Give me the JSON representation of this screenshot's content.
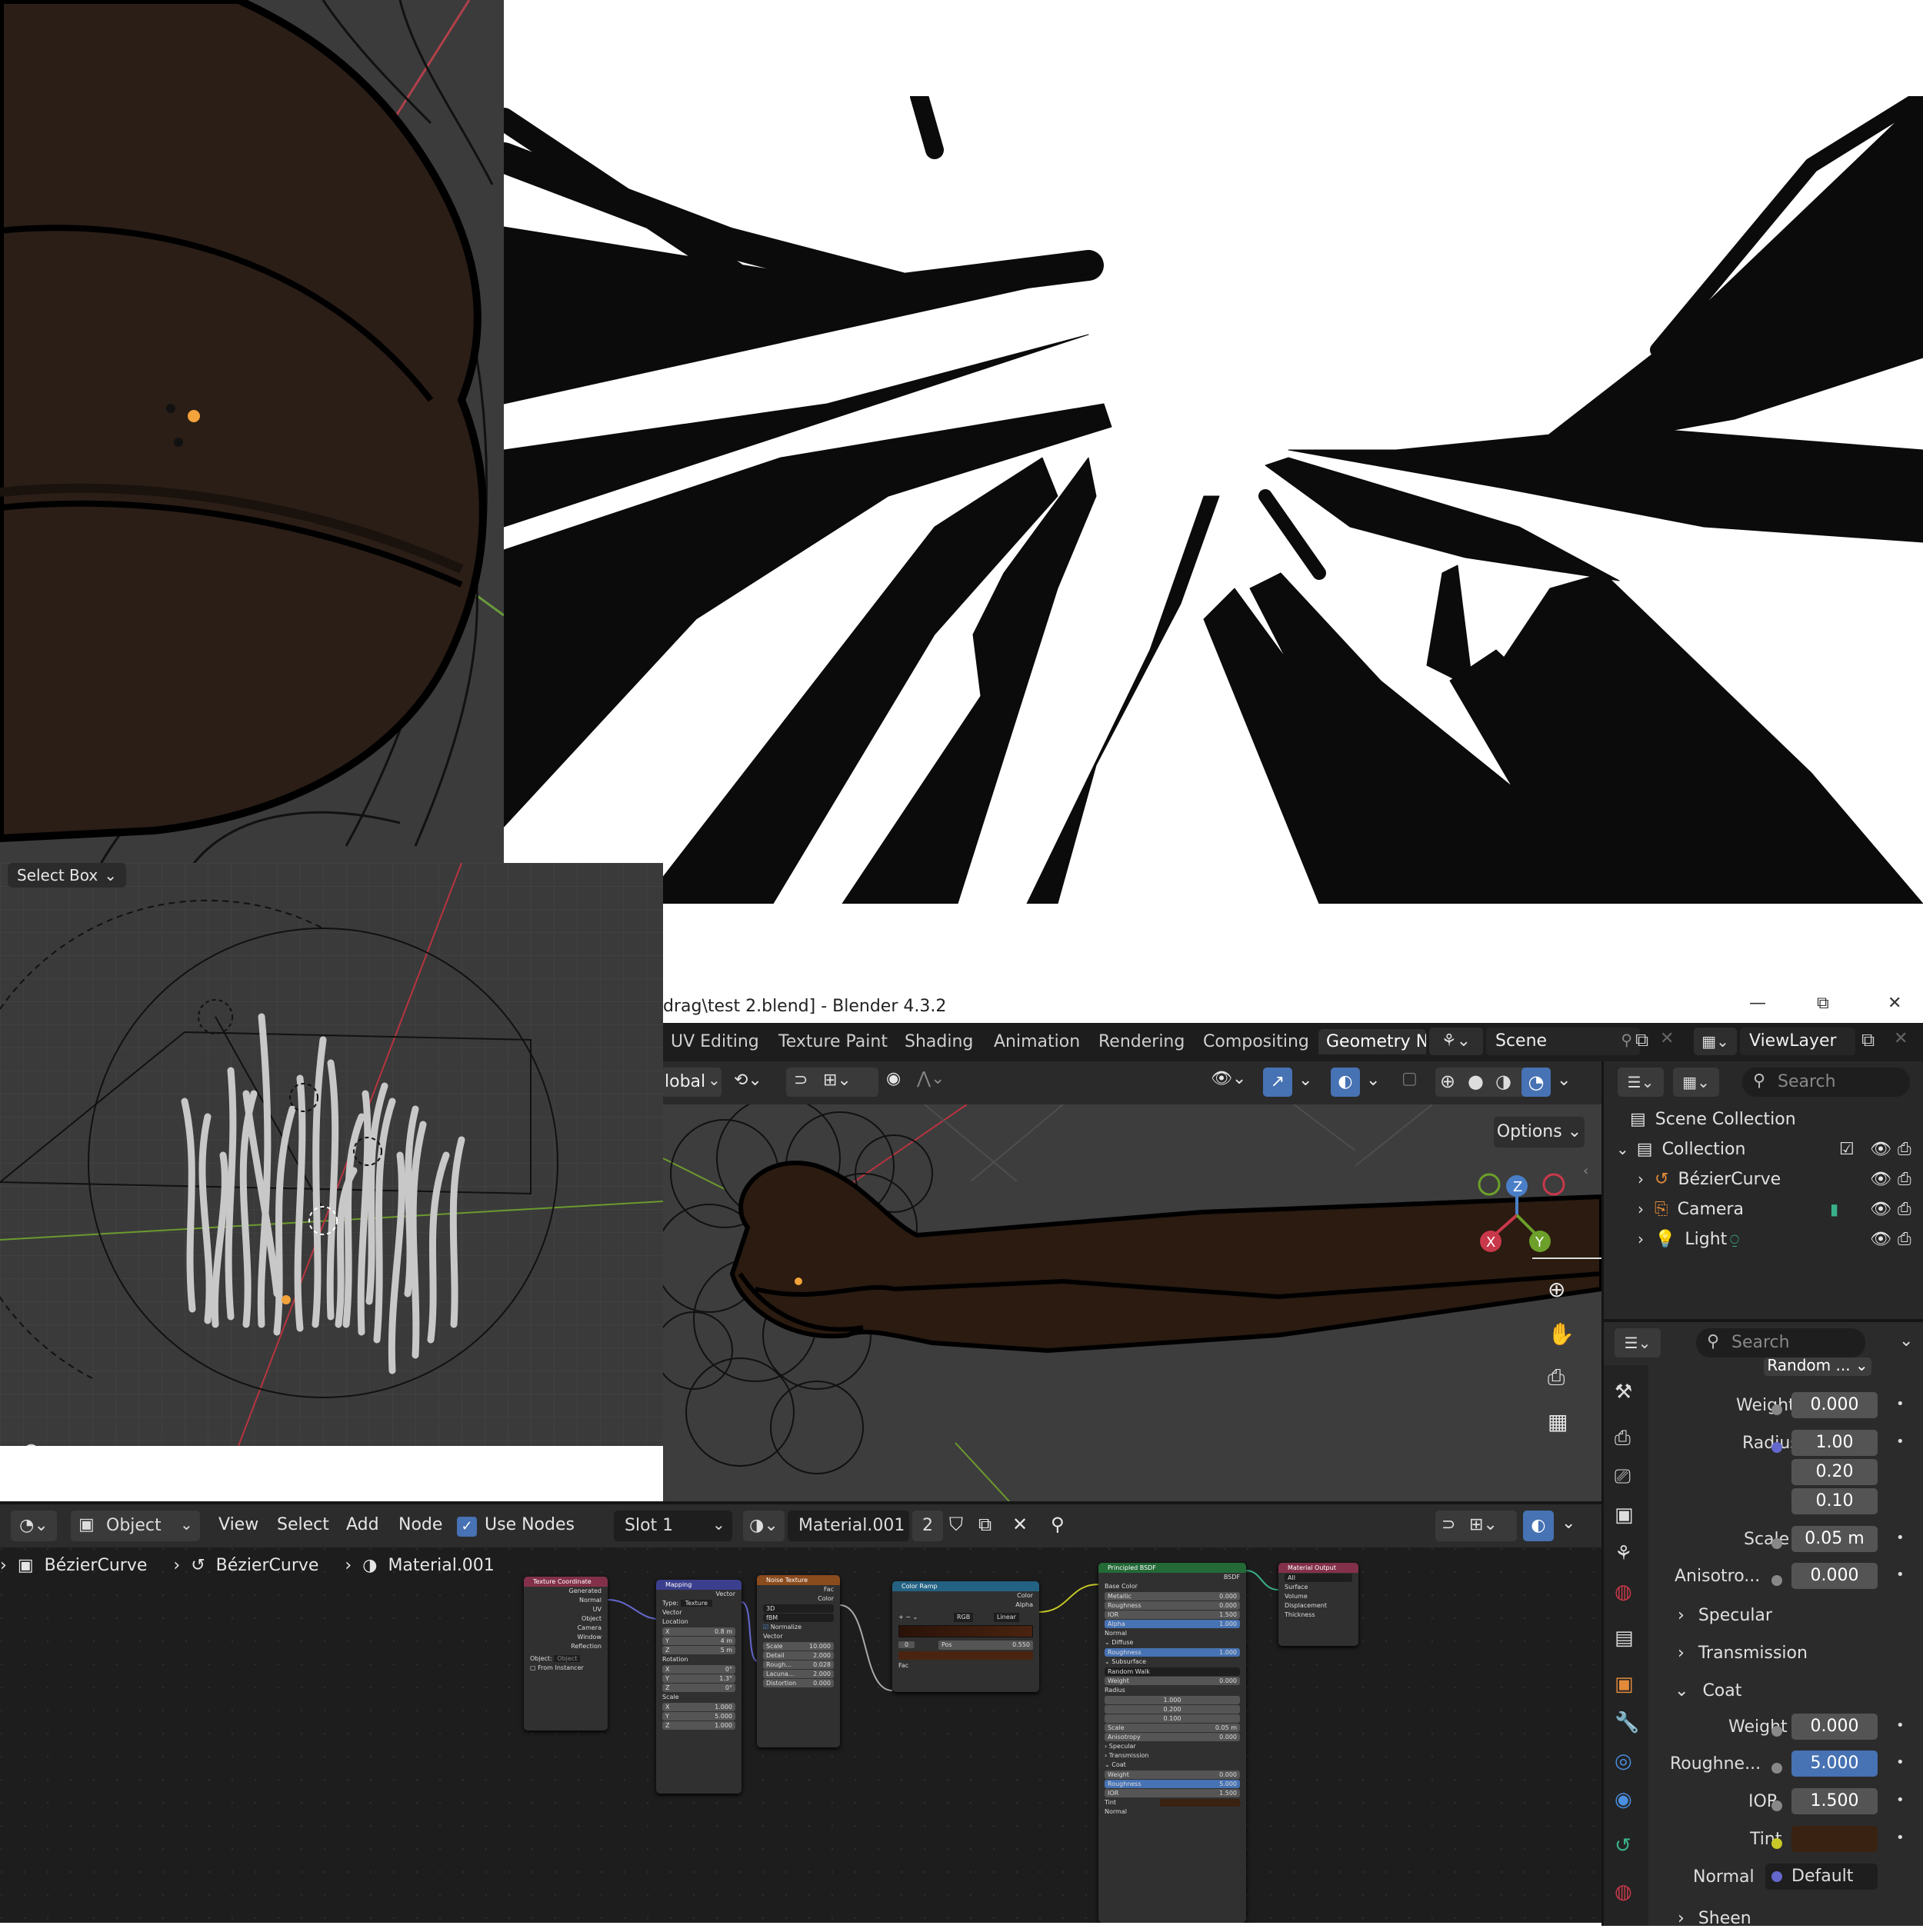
{
  "top_viewport": {
    "tool_label": "Select Box"
  },
  "title_bar": {
    "title": "drag\\test 2.blend] - Blender 4.3.2",
    "minimize": "—",
    "restore": "⧉",
    "close": "✕"
  },
  "workspace_tabs": [
    {
      "label": "UV Editing"
    },
    {
      "label": "Texture Paint"
    },
    {
      "label": "Shading"
    },
    {
      "label": "Animation"
    },
    {
      "label": "Rendering"
    },
    {
      "label": "Compositing"
    },
    {
      "label": "Geometry N",
      "active": true
    }
  ],
  "scene_selector": {
    "label": "Scene"
  },
  "view_layer_selector": {
    "label": "ViewLayer"
  },
  "viewport_header": {
    "orientation": "lobal",
    "options_label": "Options"
  },
  "outliner": {
    "search_placeholder": "Search",
    "scene_collection": "Scene Collection",
    "collection": "Collection",
    "items": [
      {
        "label": "BézierCurve"
      },
      {
        "label": "Camera"
      },
      {
        "label": "Light"
      }
    ]
  },
  "properties": {
    "search_placeholder": "Search",
    "top_partial": "Random ...",
    "subsurface": {
      "weight_label": "Weight",
      "weight": "0.000",
      "radius_label": "Radius",
      "radius": [
        "1.00",
        "0.20",
        "0.10"
      ],
      "scale_label": "Scale",
      "scale": "0.05 m",
      "anisotropy_label": "Anisotro...",
      "anisotropy": "0.000"
    },
    "panels": [
      "Specular",
      "Transmission",
      "Coat"
    ],
    "coat": {
      "weight_label": "Weight",
      "weight": "0.000",
      "roughness_label": "Roughne...",
      "roughness": "5.000",
      "ior_label": "IOR",
      "ior": "1.500",
      "tint_label": "Tint",
      "normal_label": "Normal",
      "normal": "Default"
    },
    "sheen": "Sheen",
    "colors": {
      "tint": "#3a2212",
      "accent": "#4772b3"
    }
  },
  "node_editor_header": {
    "mode": "Object",
    "menus": [
      "View",
      "Select",
      "Add",
      "Node"
    ],
    "use_nodes_label": "Use Nodes",
    "slot": "Slot 1",
    "material": "Material.001",
    "users": "2"
  },
  "breadcrumb": [
    "BézierCurve",
    "BézierCurve",
    "Material.001"
  ],
  "nodes": {
    "texture_coordinate": {
      "title": "Texture Coordinate",
      "outputs": [
        "Generated",
        "Normal",
        "UV",
        "Object",
        "Camera",
        "Window",
        "Reflection"
      ],
      "object_label": "Object:",
      "object_field": "Object",
      "from_instancer": "From Instancer"
    },
    "mapping": {
      "title": "Mapping",
      "out": "Vector",
      "type_label": "Type:",
      "type": "Texture",
      "vector": "Vector",
      "location": "Location",
      "loc": [
        [
          "X",
          "0.8 m"
        ],
        [
          "Y",
          "4 m"
        ],
        [
          "Z",
          "5 m"
        ]
      ],
      "rotation": "Rotation",
      "rot": [
        [
          "X",
          "0°"
        ],
        [
          "Y",
          "1.3°"
        ],
        [
          "Z",
          "0°"
        ]
      ],
      "scale": "Scale",
      "scl": [
        [
          "X",
          "1.000"
        ],
        [
          "Y",
          "5.000"
        ],
        [
          "Z",
          "1.000"
        ]
      ]
    },
    "noise_texture": {
      "title": "Noise Texture",
      "outs": [
        "Fac",
        "Color"
      ],
      "dim": "3D",
      "type": "fBM",
      "normalize": "Normalize",
      "vector": "Vector",
      "fields": [
        [
          "Scale",
          "10.000"
        ],
        [
          "Detail",
          "2.000"
        ],
        [
          "Rough...",
          "0.028"
        ],
        [
          "Lacuna...",
          "2.000"
        ],
        [
          "Distortion",
          "0.000"
        ]
      ]
    },
    "color_ramp": {
      "title": "Color Ramp",
      "outs": [
        "Color",
        "Alpha"
      ],
      "mode": "RGB",
      "interp": "Linear",
      "index": "0",
      "pos_label": "Pos",
      "pos": "0.550",
      "fac": "Fac"
    },
    "principled": {
      "title": "Principled BSDF",
      "out": "BSDF",
      "base_color": "Base Color",
      "fields": [
        [
          "Metallic",
          "0.000"
        ],
        [
          "Roughness",
          "0.000"
        ],
        [
          "IOR",
          "1.500"
        ],
        [
          "Alpha",
          "1.000"
        ]
      ],
      "normal": "Normal",
      "diffuse": "Diffuse",
      "diff_rough": [
        "Roughness",
        "1.000"
      ],
      "subsurface": "Subsurface",
      "method": "Random Walk",
      "ss_weight": [
        "Weight",
        "0.000"
      ],
      "radius": "Radius",
      "radius_vals": [
        "1.000",
        "0.200",
        "0.100"
      ],
      "ss_scale": [
        "Scale",
        "0.05 m"
      ],
      "ss_aniso": [
        "Anisotropy",
        "0.000"
      ],
      "specular": "Specular",
      "transmission": "Transmission",
      "coat": "Coat",
      "coat_fields": [
        [
          "Weight",
          "0.000"
        ],
        [
          "Roughness",
          "5.000"
        ],
        [
          "IOR",
          "1.500"
        ]
      ],
      "tint": "Tint",
      "coat_normal": "Normal"
    },
    "material_output": {
      "title": "Material Output",
      "target": "All",
      "ins": [
        "Surface",
        "Volume",
        "Displacement",
        "Thickness"
      ]
    }
  }
}
